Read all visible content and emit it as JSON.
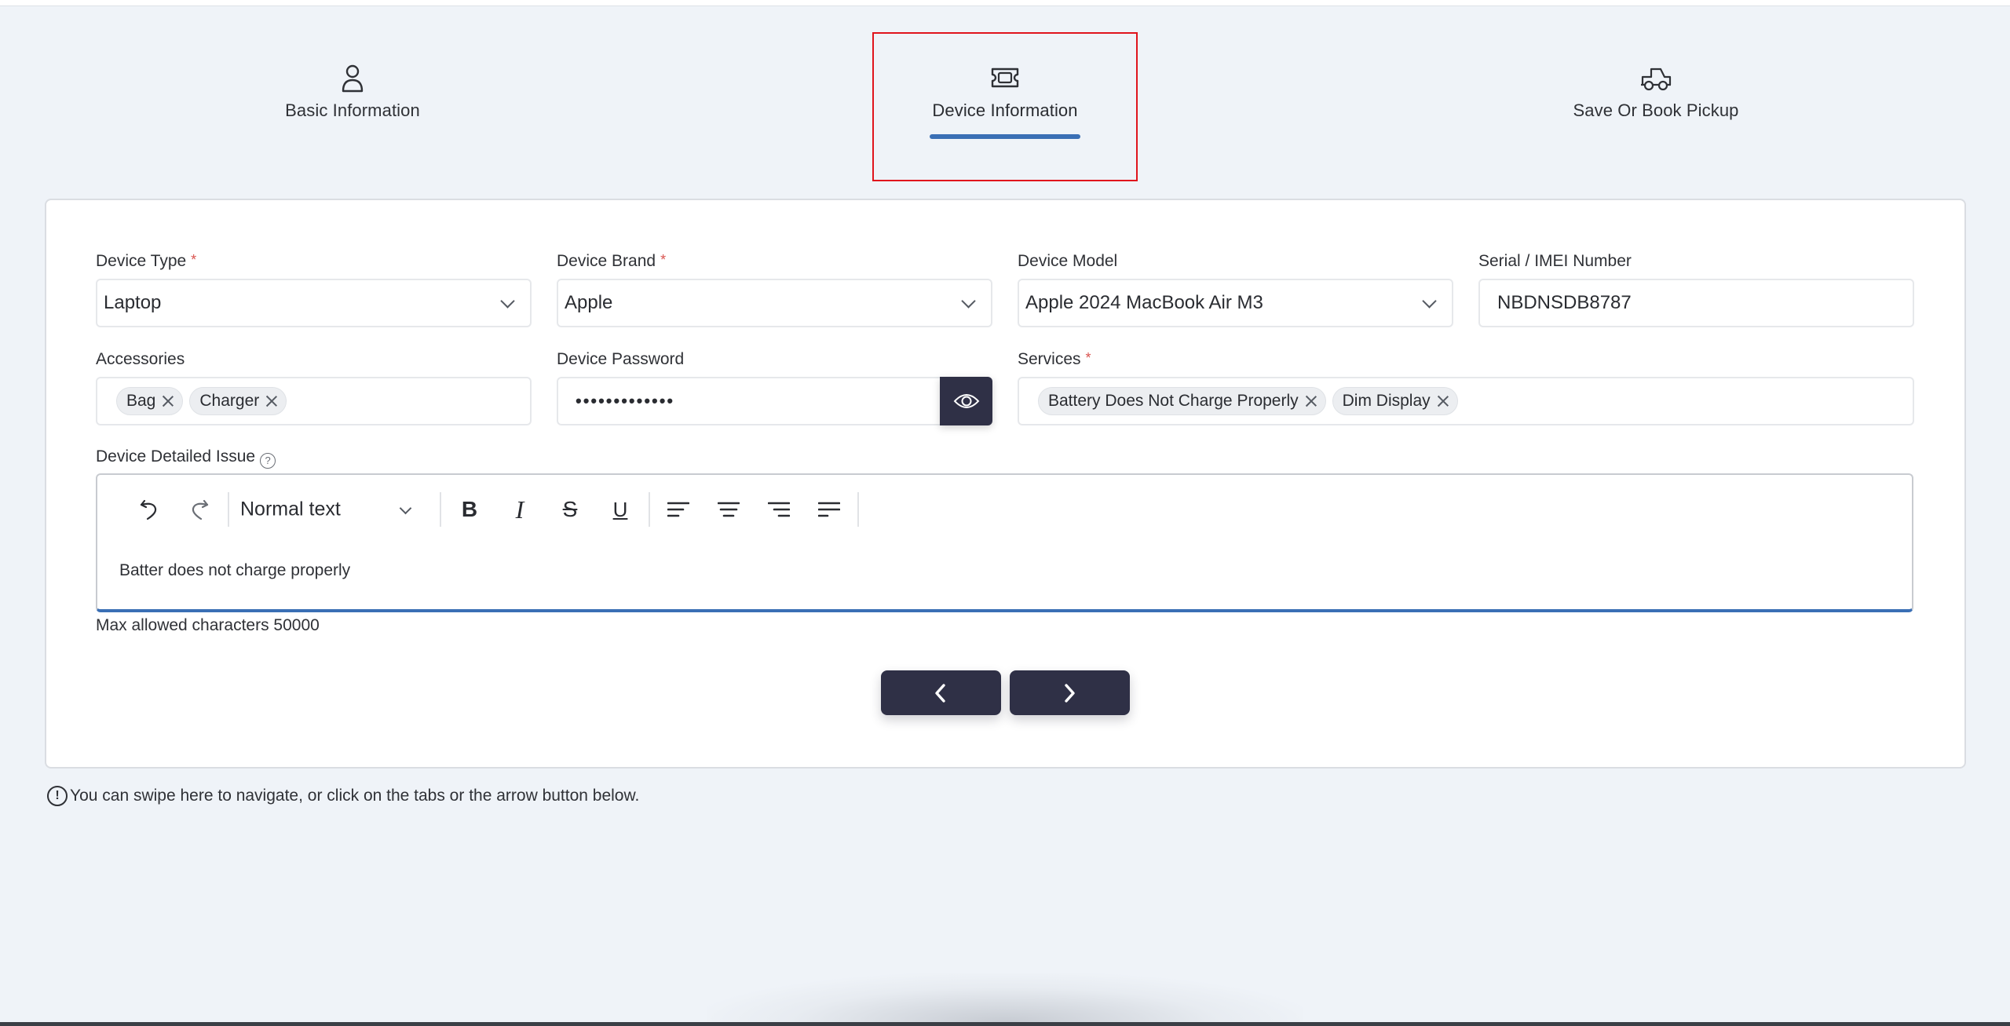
{
  "tabs": [
    {
      "label": "Basic Information",
      "icon": "user-icon",
      "active": false
    },
    {
      "label": "Device Information",
      "icon": "ticket-icon",
      "active": true
    },
    {
      "label": "Save Or Book Pickup",
      "icon": "truck-icon",
      "active": false
    }
  ],
  "colors": {
    "accent": "#3a6fb5",
    "button_dark": "#2f3046",
    "required": "#d9534f",
    "highlight": "#e0141c",
    "background": "#eff3f8"
  },
  "form": {
    "device_type": {
      "label": "Device Type",
      "required_mark": "*",
      "value": "Laptop"
    },
    "device_brand": {
      "label": "Device Brand",
      "required_mark": "*",
      "value": "Apple"
    },
    "device_model": {
      "label": "Device Model",
      "value": "Apple 2024 MacBook Air M3"
    },
    "serial": {
      "label": "Serial / IMEI Number",
      "value": "NBDNSDB8787"
    },
    "accessories": {
      "label": "Accessories",
      "chips": [
        "Bag",
        "Charger"
      ]
    },
    "password": {
      "label": "Device Password",
      "masked_value": "•••••••••••••"
    },
    "services": {
      "label": "Services",
      "required_mark": "*",
      "chips": [
        "Battery Does Not Charge Properly",
        "Dim Display"
      ]
    },
    "detailed_issue": {
      "label": "Device Detailed Issue",
      "help_glyph": "?",
      "text_style": "Normal text",
      "content": "Batter does not charge properly",
      "max_chars_note": "Max allowed characters 50000"
    }
  },
  "toolbar": {
    "undo": "undo-icon",
    "redo": "redo-icon",
    "bold": "B",
    "italic": "I",
    "strike": "S",
    "underline": "U"
  },
  "nav": {
    "prev": "chevron-left-icon",
    "next": "chevron-right-icon"
  },
  "hint": {
    "glyph": "!",
    "text": "You can swipe here to navigate, or click on the tabs or the arrow button below."
  }
}
